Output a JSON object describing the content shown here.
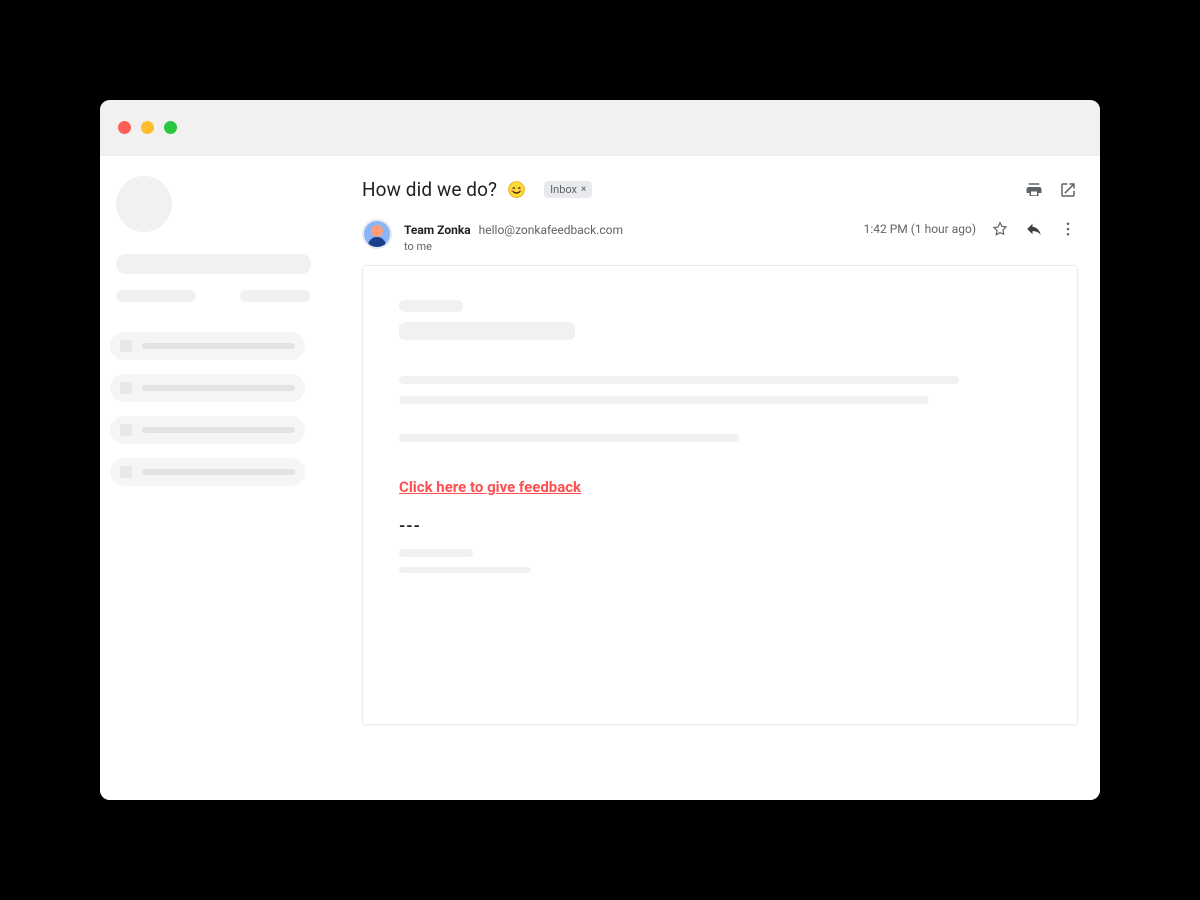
{
  "email": {
    "subject": "How did we do?",
    "label": "Inbox",
    "sender": {
      "name": "Team Zonka",
      "email": "hello@zonkafeedback.com",
      "to_line": "to me"
    },
    "timestamp": "1:42 PM (1 hour ago)",
    "feedback_link_text": "Click here to give feedback",
    "divider": "---"
  },
  "colors": {
    "link": "#ff4f4f",
    "chip_bg": "#e8eaed",
    "muted": "#5f6368"
  }
}
